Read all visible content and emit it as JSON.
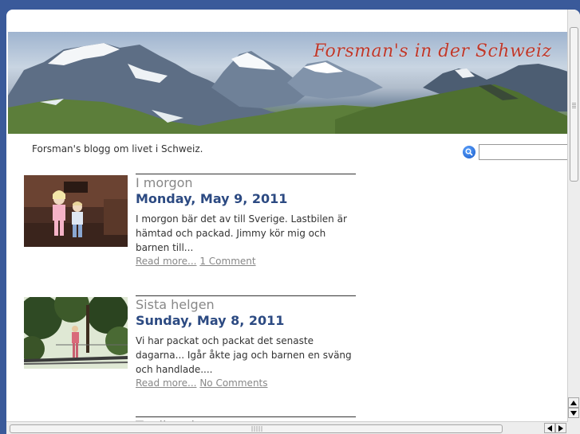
{
  "header": {
    "blog_title": "Forsman's in der Schweiz"
  },
  "tagline": "Forsman's blogg om livet i Schweiz.",
  "search": {
    "value": "",
    "icon": "search-icon"
  },
  "colors": {
    "title_red": "#c0392b",
    "date_blue": "#2c4a82",
    "link_gray": "#888888",
    "page_bg": "#3a5a9a"
  },
  "posts": [
    {
      "title": "I morgon",
      "date": "Monday, May 9, 2011",
      "excerpt": "I morgon bär det av till Sverige. Lastbilen är hämtad och packad. Jimmy kör mig och barnen till...",
      "read_more": "Read more...",
      "comments": "1 Comment"
    },
    {
      "title": "Sista helgen",
      "date": "Sunday, May 8, 2011",
      "excerpt": "Vi har packat och packat det senaste dagarna... Igår åkte jag och barnen en sväng och handlade....",
      "read_more": "Read more...",
      "comments": "No Comments"
    },
    {
      "title": "Trading dance"
    }
  ]
}
